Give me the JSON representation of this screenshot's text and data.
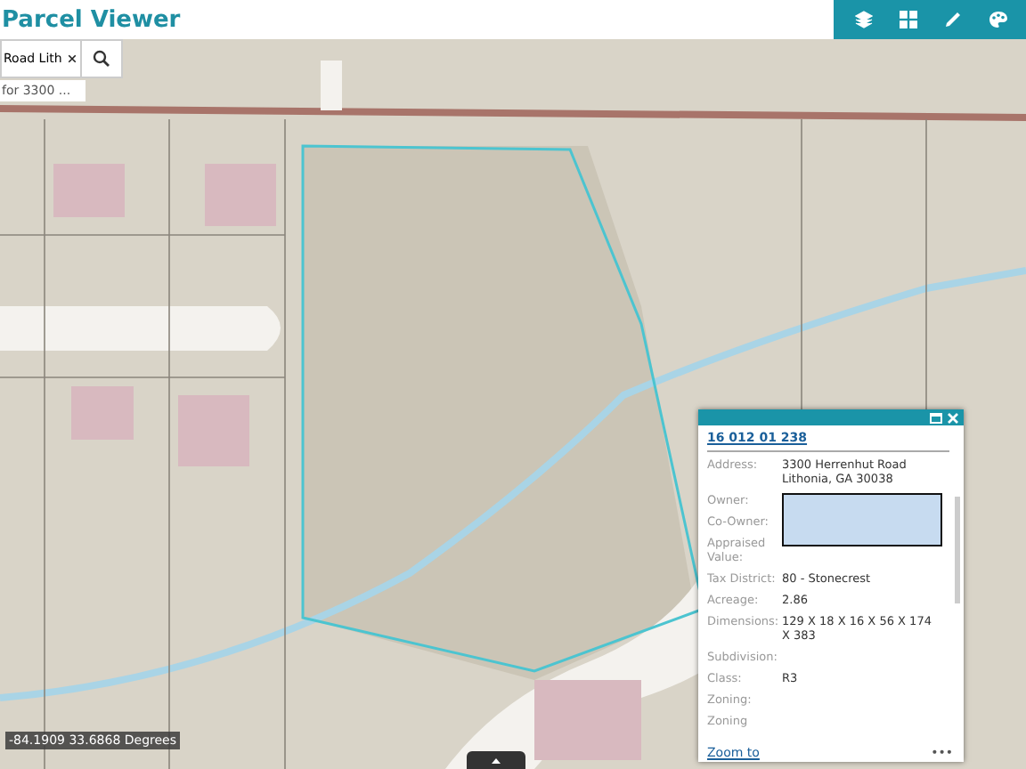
{
  "app": {
    "title": "Parcel Viewer"
  },
  "toolbar": [
    {
      "kind": "layers"
    },
    {
      "kind": "grid"
    },
    {
      "kind": "pencil"
    },
    {
      "kind": "palette"
    }
  ],
  "search": {
    "value": "Road Lith",
    "suggestion": "for 3300 ..."
  },
  "map": {
    "kind": "picture",
    "coordinates": "-84.1909 33.6868 Degrees"
  },
  "popup": {
    "title": "16 012 01 238",
    "fields": [
      {
        "label": "Address:",
        "value": "3300 Herrenhut Road\nLithonia, GA 30038",
        "redacted": false
      },
      {
        "label": "Owner:",
        "redacted": true
      },
      {
        "label": "Co-Owner:",
        "redacted": true
      },
      {
        "label": "Appraised Value:",
        "redacted": true
      },
      {
        "label": "Tax District:",
        "value": "80 - Stonecrest",
        "redacted": false
      },
      {
        "label": "Acreage:",
        "value": "2.86",
        "redacted": false
      },
      {
        "label": "Dimensions:",
        "value": "129 X 18 X 16 X 56 X 174 X 383",
        "redacted": false
      },
      {
        "label": "Subdivision:",
        "redacted": false
      },
      {
        "label": "Class:",
        "value": "R3",
        "redacted": false
      },
      {
        "label": "Zoning:",
        "redacted": false
      },
      {
        "label": "Zoning",
        "redacted": false
      }
    ],
    "zoom_link": "Zoom to",
    "more": "•••"
  }
}
